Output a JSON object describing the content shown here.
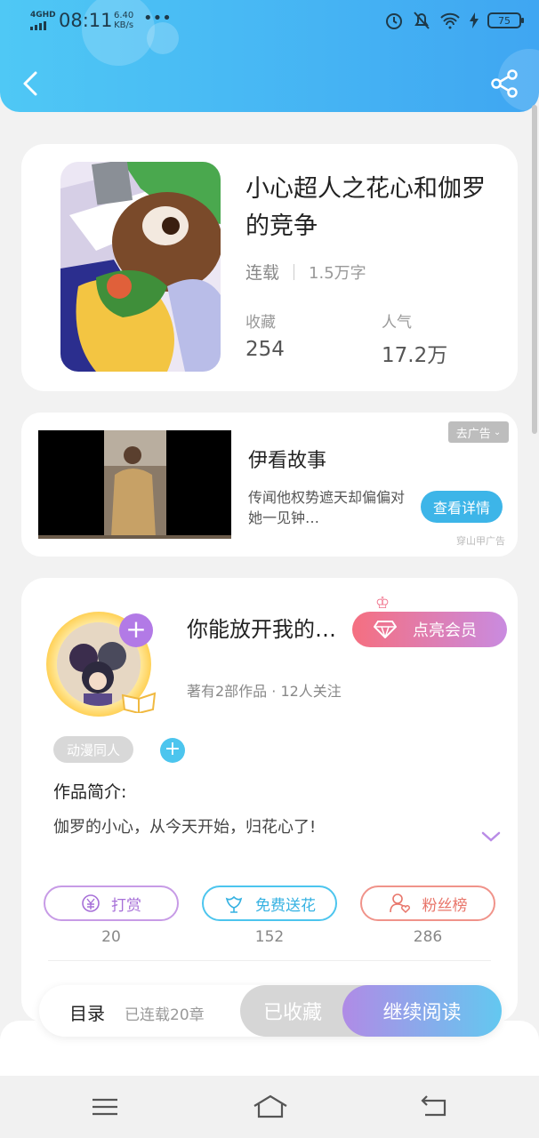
{
  "status_bar": {
    "network": "4GHD",
    "time": "08:11",
    "speed_value": "6.40",
    "speed_unit": "KB/s",
    "more": "•••",
    "battery": "75"
  },
  "book": {
    "title": "小心超人之花心和伽罗的竞争",
    "status": "连载",
    "words": "1.5万字",
    "favorites_label": "收藏",
    "favorites_value": "254",
    "popularity_label": "人气",
    "popularity_value": "17.2万"
  },
  "ad": {
    "close_label": "去广告",
    "title": "伊看故事",
    "description": "传闻他权势遮天却偏偏对她一见钟…",
    "button": "查看详情",
    "source": "穿山甲广告"
  },
  "author": {
    "name": "你能放开我的…",
    "vip_button": "点亮会员",
    "meta": "著有2部作品 · 12人关注",
    "tag": "动漫同人",
    "intro_label": "作品简介:",
    "intro_text": "伽罗的小心，从今天开始，归花心了!"
  },
  "actions": [
    {
      "label": "打赏",
      "count": "20"
    },
    {
      "label": "免费送花",
      "count": "152"
    },
    {
      "label": "粉丝榜",
      "count": "286"
    }
  ],
  "read_bar": {
    "toc": "目录",
    "toc_sub": "已连载20章",
    "collected": "已收藏",
    "continue": "继续阅读"
  },
  "colors": {
    "header_start": "#4fc8f5",
    "header_end": "#3fa6f2",
    "vip_start": "#f56f80",
    "vip_end": "#c98be0",
    "accent_blue": "#3db5e8",
    "accent_purple": "#b27ae6"
  }
}
